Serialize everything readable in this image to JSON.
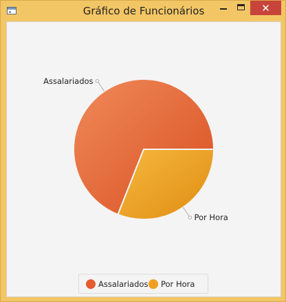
{
  "window": {
    "title": "Gráfico de Funcionários",
    "close_symbol": "✕"
  },
  "chart_data": {
    "type": "pie",
    "title": "",
    "slices": [
      {
        "label": "Assalariados",
        "value": 69,
        "color": "#e8593a"
      },
      {
        "label": "Por Hora",
        "value": 31,
        "color": "#f0a020"
      }
    ]
  },
  "legend": {
    "items": [
      {
        "label": "Assalariados",
        "color": "#e35d2f"
      },
      {
        "label": "Por Hora",
        "color": "#f0a020"
      }
    ]
  }
}
